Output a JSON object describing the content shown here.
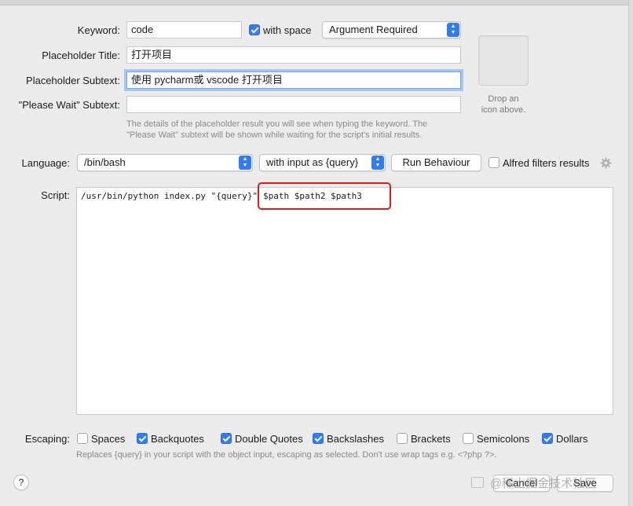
{
  "form": {
    "keyword_label": "Keyword:",
    "keyword_value": "code",
    "with_space_label": "with space",
    "argument_option": "Argument Required",
    "placeholder_title_label": "Placeholder Title:",
    "placeholder_title_value": "打开项目",
    "placeholder_subtext_label": "Placeholder Subtext:",
    "placeholder_subtext_value": "使用 pycharm或 vscode 打开项目",
    "please_wait_label": "\"Please Wait\" Subtext:",
    "please_wait_value": "",
    "icon_drop_line1": "Drop an",
    "icon_drop_line2": "icon above.",
    "hint_line1": "The details of the placeholder result you will see when typing the keyword. The",
    "hint_line2": "\"Please Wait\" subtext will be shown while waiting for the script's initial results."
  },
  "language": {
    "label": "Language:",
    "value": "/bin/bash",
    "input_mode": "with input as {query}",
    "run_behaviour_label": "Run Behaviour",
    "alfred_filters_label": "Alfred filters results"
  },
  "script": {
    "label": "Script:",
    "code_prefix": "/usr/bin/python index.py \"{query}\"",
    "code_highlighted": "$path $path2 $path3",
    "highlight_color": "#e0191c"
  },
  "escaping": {
    "label": "Escaping:",
    "options": [
      {
        "label": "Spaces",
        "checked": false
      },
      {
        "label": "Backquotes",
        "checked": true
      },
      {
        "label": "Double Quotes",
        "checked": true
      },
      {
        "label": "Backslashes",
        "checked": true
      },
      {
        "label": "Brackets",
        "checked": false
      },
      {
        "label": "Semicolons",
        "checked": false
      },
      {
        "label": "Dollars",
        "checked": true
      }
    ],
    "note": "Replaces {query} in your script with the object input, escaping as selected. Don't use wrap tags e.g. <?php ?>."
  },
  "footer": {
    "help_label": "?",
    "cancel_label": "Cancel",
    "save_label": "Save",
    "watermark": "@稀土掘金技术社区"
  },
  "colors": {
    "accent": "#2f7cf6",
    "window_bg": "#ececec"
  }
}
